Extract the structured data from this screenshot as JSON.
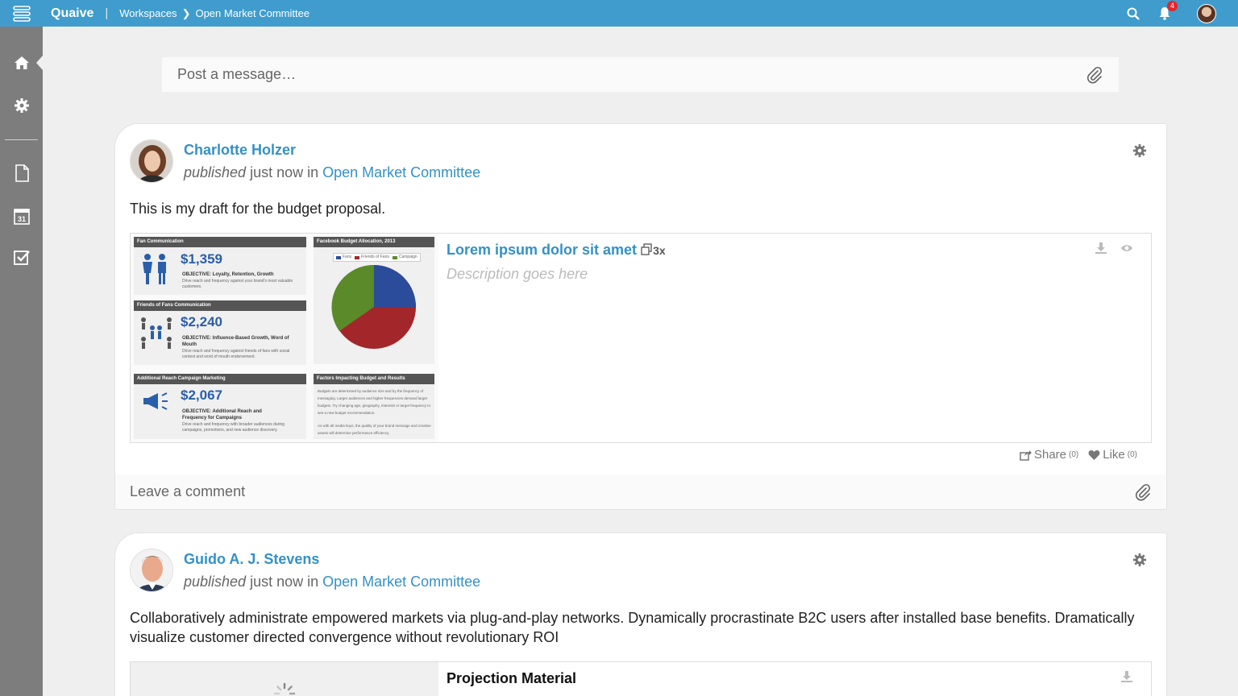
{
  "app": {
    "brand": "Quaive",
    "breadcrumb": [
      "Workspaces",
      "Open Market Committee"
    ],
    "notification_count": "4"
  },
  "composer": {
    "placeholder": "Post a message…"
  },
  "posts": [
    {
      "author": "Charlotte Holzer",
      "verb": "published",
      "when": " just now in ",
      "workspace": "Open Market Committee",
      "text": "This is my draft for the budget proposal.",
      "attachment": {
        "title": "Lorem ipsum dolor sit amet",
        "count": "3x",
        "description": "Description goes here",
        "preview": {
          "p1_header": "Fan Communication",
          "p1_value": "$1,359",
          "p1_objective": "OBJECTIVE: Loyalty, Retention, Growth",
          "p1_note": "Drive reach and frequency against your brand's most valuable customers.",
          "p2_header": "Facebook Budget Allocation, 2013",
          "p2_legend": [
            "Fans",
            "Friends of Fans",
            "Campaign"
          ],
          "p3_header": "Friends of Fans Communication",
          "p3_value": "$2,240",
          "p3_objective": "OBJECTIVE: Influence-Based Growth, Word of Mouth",
          "p3_note": "Drive reach and frequency against friends of fans with social context and word of mouth endorsement.",
          "p4_header": "Additional Reach Campaign Marketing",
          "p4_value": "$2,067",
          "p4_objective": "OBJECTIVE: Additional Reach and Frequency for Campaigns",
          "p4_note": "Drive reach and frequency with broader audiences during campaigns, promotions, and new audience discovery.",
          "p5_header": "Factors Impacting Budget and Results",
          "p5_text": "Budgets are determined by audience size and by the frequency of messaging. Larger audiences and higher frequencies demand larger budgets. Try changing age, geography, interests or target frequency to see a new budget recommendation.",
          "p5_text2": "As with all media buys, the quality of your brand message and creative assets will determine performance efficiency."
        }
      },
      "share_label": "Share",
      "share_count": "(0)",
      "like_label": "Like",
      "like_count": "(0)",
      "comment_placeholder": "Leave a comment"
    },
    {
      "author": "Guido A. J. Stevens",
      "verb": "published",
      "when": " just now in ",
      "workspace": "Open Market Committee",
      "text": "Collaboratively administrate empowered markets via plug-and-play networks. Dynamically procrastinate B2C users after installed base benefits. Dramatically visualize customer directed convergence without revolutionary ROI",
      "attachment": {
        "title": "Projection Material"
      }
    }
  ],
  "colors": {
    "topbar": "#3f9ccd",
    "sidebar": "#7d7d7d",
    "link": "#3391c7",
    "badge": "#e5252a"
  }
}
